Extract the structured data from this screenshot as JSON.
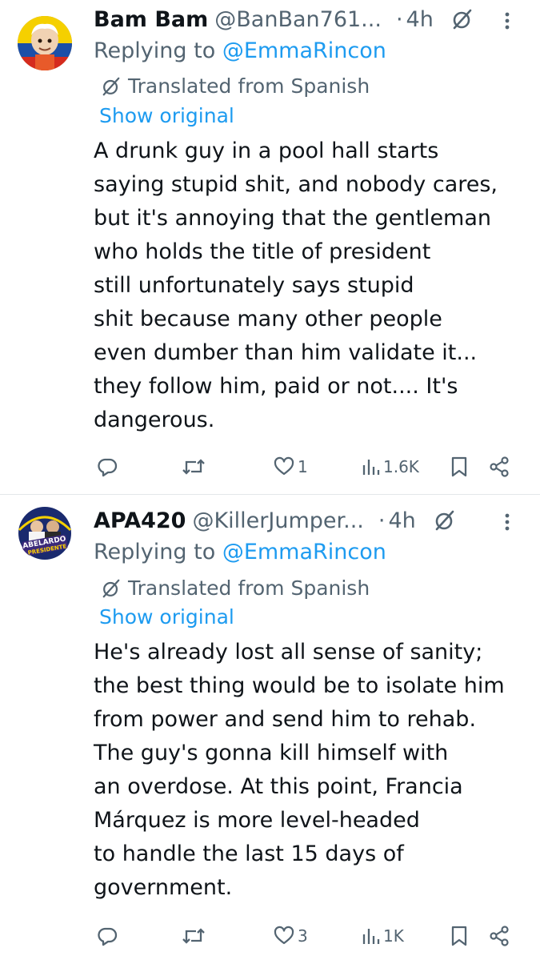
{
  "replies": [
    {
      "display_name": "Bam Bam",
      "handle": "@BanBan761...",
      "separator": "·",
      "time": "4h",
      "replying_prefix": "Replying to ",
      "replying_to": "@EmmaRincon",
      "translated_label": "Translated from Spanish",
      "show_original": "Show original",
      "text_lines": [
        "A drunk guy in a pool hall starts",
        "saying stupid shit, and nobody cares,",
        "but it's annoying that the gentleman",
        "who holds the title of president",
        "still unfortunately says stupid",
        "shit because many other people",
        "even dumber than him validate it...",
        "they follow him, paid or not.... It's",
        "dangerous."
      ],
      "likes": "1",
      "views": "1.6K",
      "avatar_colors": {
        "bg": "#c9a23a",
        "flag_yellow": "#f5d000",
        "flag_blue": "#1c4fa8",
        "flag_red": "#d52b1e"
      }
    },
    {
      "display_name": "APA420",
      "handle": "@KillerJumper...",
      "separator": "·",
      "time": "4h",
      "replying_prefix": "Replying to ",
      "replying_to": "@EmmaRincon",
      "translated_label": "Translated from Spanish",
      "show_original": "Show original",
      "text_lines": [
        "He's already lost all sense of sanity;",
        "the best thing would be to isolate him",
        "from power and send him to rehab.",
        "The guy's gonna kill himself with",
        "an overdose. At this point, Francia",
        "Márquez is more level-headed",
        "to handle the last 15 days of",
        "government."
      ],
      "likes": "3",
      "views": "1K",
      "avatar_badge_lines": [
        "ABELARDO",
        "PRESIDENTE"
      ],
      "avatar_colors": {
        "bg": "#1a2a6e",
        "badge": "#3b2a7a",
        "text": "#ffd400"
      }
    }
  ],
  "colors": {
    "text_primary": "#0f1419",
    "text_secondary": "#536471",
    "link": "#1d9bf0",
    "divider": "#e3e7ea"
  },
  "icons": [
    "reply-icon",
    "retweet-icon",
    "like-icon",
    "views-icon",
    "bookmark-icon",
    "share-icon",
    "grok-icon",
    "more-icon",
    "translate-icon"
  ]
}
